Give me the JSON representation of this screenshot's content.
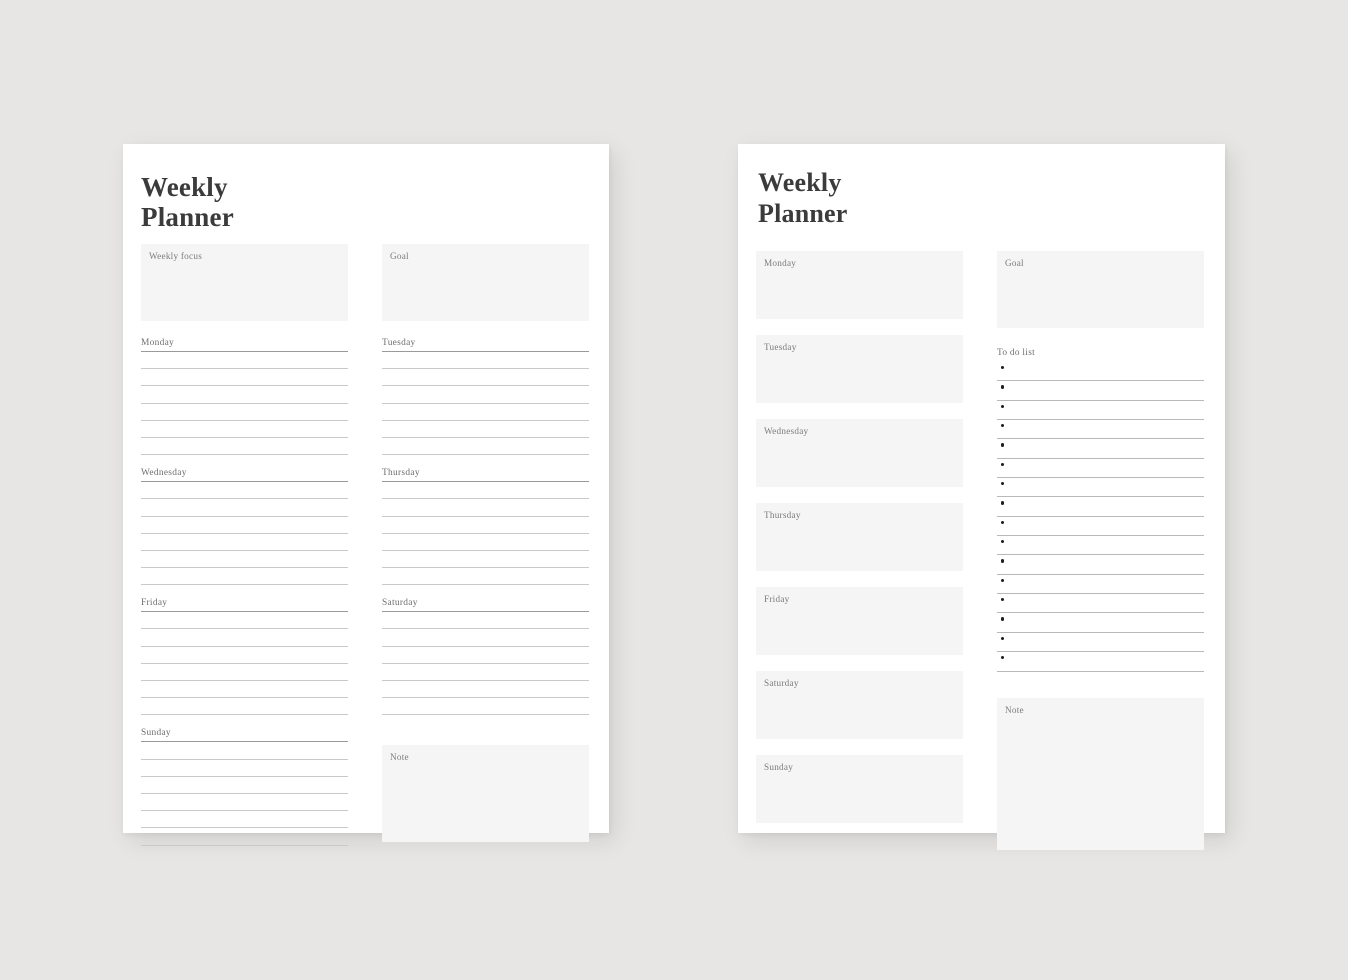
{
  "background_color": "#e7e6e4",
  "sheet_color": "#ffffff",
  "box_fill_color": "#f5f5f5",
  "rule_color": "#c9c9c9",
  "label_color": "#6e6e6e",
  "title_color": "#3b3b3b",
  "pages": [
    {
      "id": "page-lined",
      "title_line1": "Weekly",
      "title_line2": "Planner",
      "boxes": {
        "weekly_focus": "Weekly focus",
        "goal": "Goal",
        "note": "Note"
      },
      "day_sections": [
        {
          "label": "Monday",
          "lines": 7,
          "column": "left"
        },
        {
          "label": "Tuesday",
          "lines": 7,
          "column": "right"
        },
        {
          "label": "Wednesday",
          "lines": 7,
          "column": "left"
        },
        {
          "label": "Thursday",
          "lines": 7,
          "column": "right"
        },
        {
          "label": "Friday",
          "lines": 7,
          "column": "left"
        },
        {
          "label": "Saturday",
          "lines": 7,
          "column": "right"
        },
        {
          "label": "Sunday",
          "lines": 7,
          "column": "left"
        }
      ]
    },
    {
      "id": "page-boxed",
      "title_line1": "Weekly",
      "title_line2": "Planner",
      "boxes": {
        "goal": "Goal",
        "note": "Note"
      },
      "todo": {
        "heading": "To do list",
        "item_count": 16,
        "bullet_glyph": "•"
      },
      "day_boxes": [
        {
          "label": "Monday"
        },
        {
          "label": "Tuesday"
        },
        {
          "label": "Wednesday"
        },
        {
          "label": "Thursday"
        },
        {
          "label": "Friday"
        },
        {
          "label": "Saturday"
        },
        {
          "label": "Sunday"
        }
      ]
    }
  ]
}
